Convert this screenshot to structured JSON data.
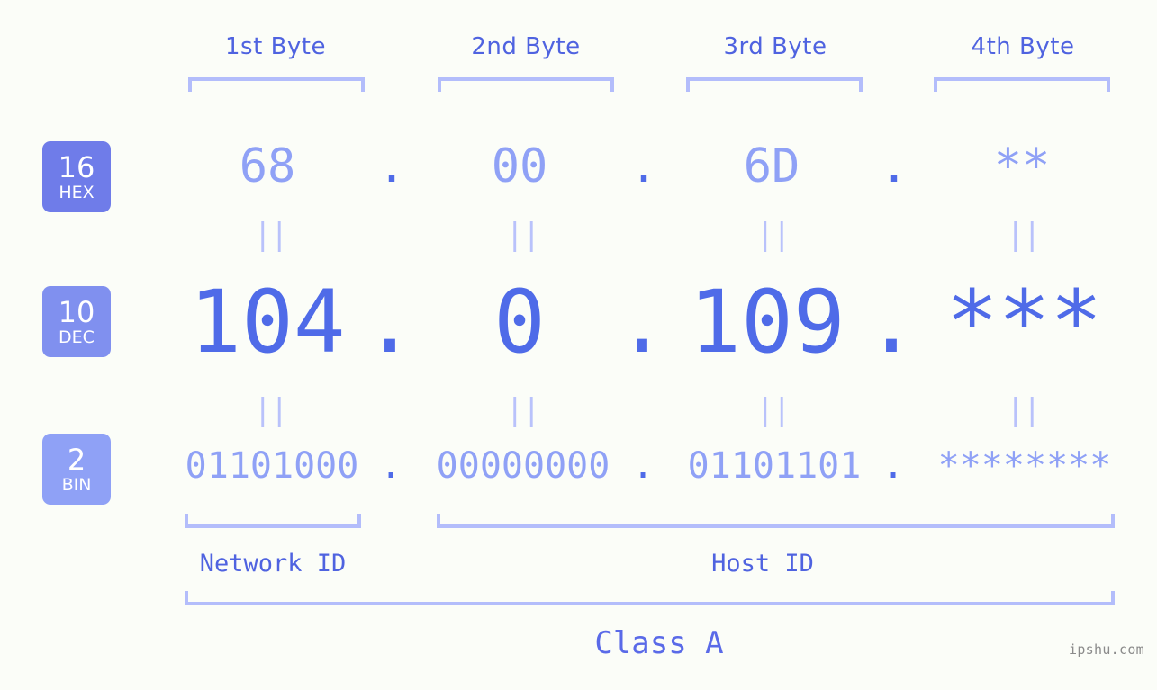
{
  "meta": {
    "watermark": "ipshu.com",
    "background_color": "#fbfdf8",
    "accent_dark": "#4f6be8",
    "accent_light": "#8fa1f6",
    "bracket_color": "#b3bdfb",
    "eq_color": "#b9c2fb"
  },
  "byte_headers": [
    {
      "label": "1st Byte"
    },
    {
      "label": "2nd Byte"
    },
    {
      "label": "3rd Byte"
    },
    {
      "label": "4th Byte"
    }
  ],
  "radix_badges": [
    {
      "number": "16",
      "system": "HEX",
      "color": "#6f7ce9"
    },
    {
      "number": "10",
      "system": "DEC",
      "color": "#8090ef"
    },
    {
      "number": "2",
      "system": "BIN",
      "color": "#8fa1f6"
    }
  ],
  "rows": {
    "hex": {
      "radix": "16",
      "system": "HEX",
      "values": [
        "68",
        "00",
        "6D",
        "**"
      ],
      "separator": "."
    },
    "dec": {
      "radix": "10",
      "system": "DEC",
      "values": [
        "104",
        "0",
        "109",
        "***"
      ],
      "separator": "."
    },
    "bin": {
      "radix": "2",
      "system": "BIN",
      "values": [
        "01101000",
        "00000000",
        "01101101",
        "********"
      ],
      "separator": "."
    }
  },
  "equals_glyph": "||",
  "segments": [
    {
      "label": "Network ID"
    },
    {
      "label": "Host ID"
    }
  ],
  "class": {
    "label": "Class A"
  }
}
